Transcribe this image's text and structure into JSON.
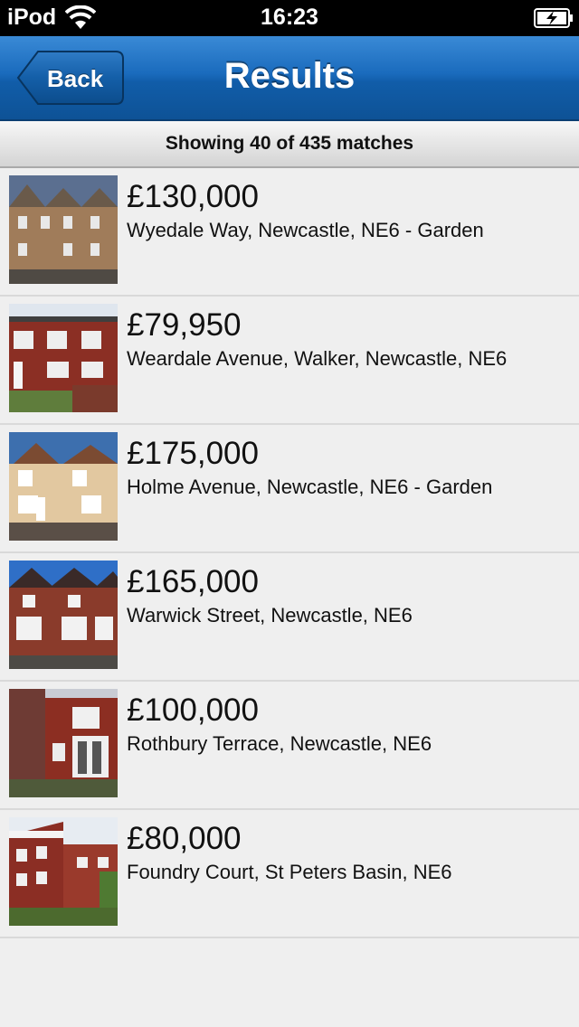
{
  "status_bar": {
    "carrier": "iPod",
    "time": "16:23"
  },
  "nav": {
    "back_label": "Back",
    "title": "Results"
  },
  "summary": {
    "text": "Showing 40 of 435 matches"
  },
  "results": [
    {
      "price": "£130,000",
      "address": "Wyedale Way, Newcastle, NE6 - Garden"
    },
    {
      "price": "£79,950",
      "address": "Weardale Avenue, Walker, Newcastle, NE6"
    },
    {
      "price": "£175,000",
      "address": "Holme Avenue, Newcastle, NE6 - Garden"
    },
    {
      "price": "£165,000",
      "address": "Warwick Street, Newcastle, NE6"
    },
    {
      "price": "£100,000",
      "address": "Rothbury Terrace, Newcastle, NE6"
    },
    {
      "price": "£80,000",
      "address": "Foundry Court, St Peters Basin, NE6"
    }
  ],
  "colors": {
    "nav_blue": "#1a6bbd",
    "list_bg": "#efefef"
  }
}
